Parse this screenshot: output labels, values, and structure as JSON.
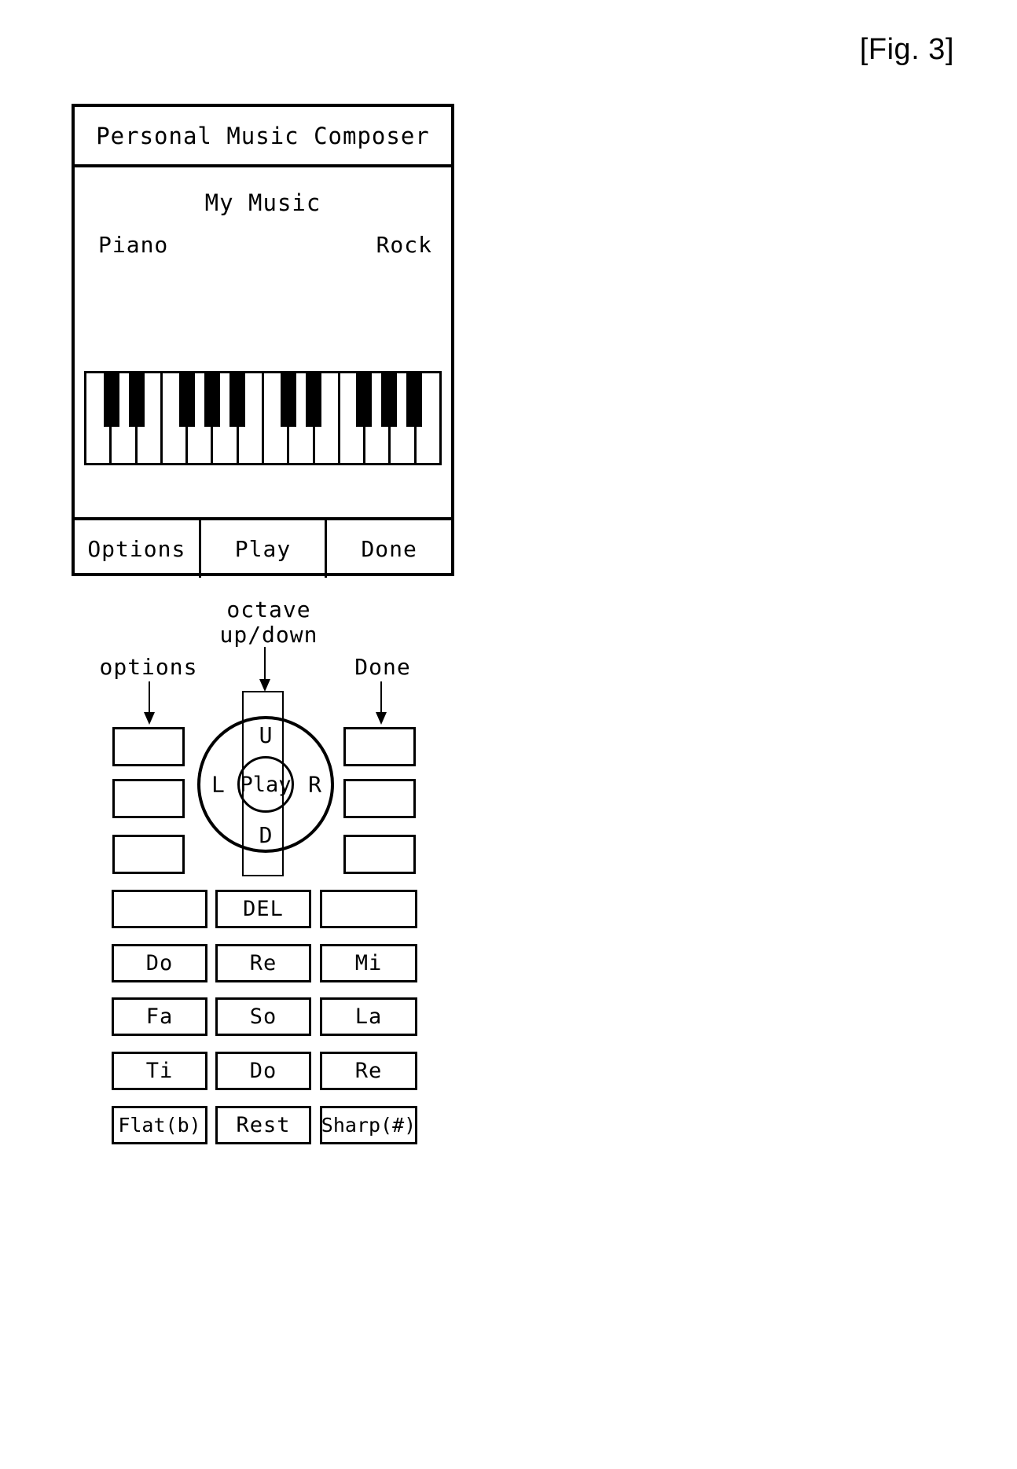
{
  "figure": {
    "label": "[Fig. 3]"
  },
  "device": {
    "title": "Personal Music Composer",
    "screen_title": "My Music",
    "instrument": "Piano",
    "genre": "Rock",
    "softkeys": [
      "Options",
      "Play",
      "Done"
    ],
    "keyboard": {
      "white_key_count": 14,
      "black_key_groups": [
        2,
        3,
        2,
        3
      ],
      "white_key_fill": "#ffffff",
      "black_key_fill": "#000000"
    }
  },
  "annotations": {
    "options": "options",
    "octave": "octave\nup/down",
    "octave_line1": "octave",
    "octave_line2": "up/down",
    "done": "Done"
  },
  "dpad": {
    "up": "U",
    "down": "D",
    "left": "L",
    "right": "R",
    "center": "Play"
  },
  "keypad": {
    "left_column": [
      "",
      "",
      ""
    ],
    "right_column": [
      "",
      "",
      ""
    ],
    "grid_rows": [
      [
        "",
        "DEL",
        ""
      ],
      [
        "Do",
        "Re",
        "Mi"
      ],
      [
        "Fa",
        "So",
        "La"
      ],
      [
        "Ti",
        "Do",
        "Re"
      ],
      [
        "Flat(b)",
        "Rest",
        "Sharp(#)"
      ]
    ]
  },
  "colors": {
    "line": "#000000",
    "background": "#ffffff"
  }
}
